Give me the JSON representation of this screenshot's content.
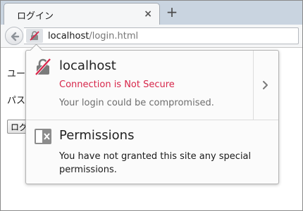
{
  "tab": {
    "title": "ログイン",
    "close_label": "×",
    "new_tab_label": "+"
  },
  "address_bar": {
    "url_host": "localhost",
    "url_path": "/login.html"
  },
  "page": {
    "line1": "ユー",
    "line2": "パス",
    "button_label": "ログ"
  },
  "identity_panel": {
    "host": "localhost",
    "connection_status": "Connection is Not Secure",
    "warning": "Your login could be compromised.",
    "permissions_title": "Permissions",
    "permissions_text": "You have not granted this site any special permissions."
  },
  "icons": {
    "insecure_lock": "insecure-lock-icon",
    "permissions": "permissions-icon",
    "more": "chevron-right-icon",
    "back": "back-arrow-icon"
  },
  "colors": {
    "not_secure": "#d7264a",
    "tabstrip": "#c9d4e0"
  }
}
